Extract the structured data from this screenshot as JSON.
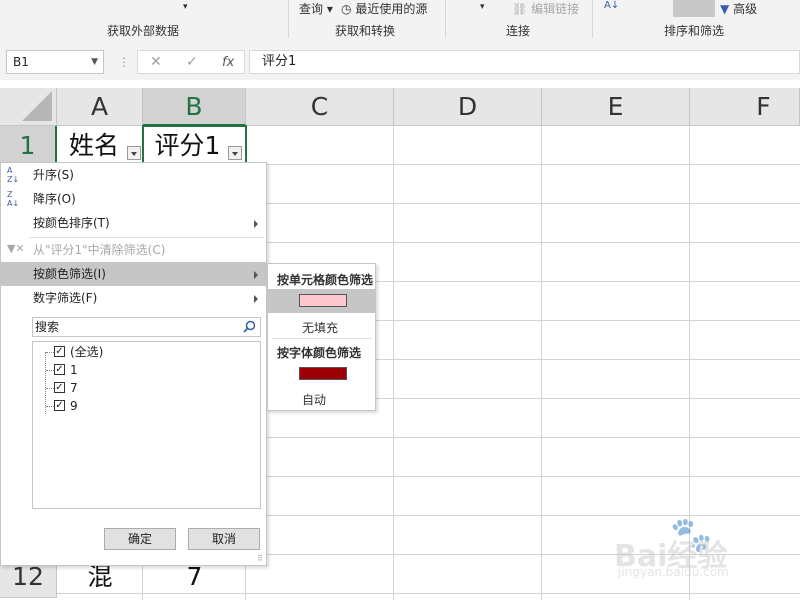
{
  "ribbon": {
    "groups": [
      {
        "label": "获取外部数据"
      },
      {
        "label": "获取和转换"
      },
      {
        "label": "连接"
      },
      {
        "label": "排序和筛选"
      }
    ],
    "query_label": "查询",
    "recent_sources_label": "最近使用的源",
    "edit_links_label": "编辑链接",
    "advanced_label": "高级"
  },
  "formula_bar": {
    "name_box": "B1",
    "cancel_icon": "✕",
    "confirm_icon": "✓",
    "fx_icon": "fx",
    "formula": "评分1"
  },
  "columns": [
    "A",
    "B",
    "C",
    "D",
    "E",
    "F"
  ],
  "rows": {
    "first": {
      "number": "1",
      "a": "姓名",
      "b": "评分1"
    },
    "last": {
      "number": "12",
      "a": "混",
      "b": "7"
    }
  },
  "filter_menu": {
    "sort_asc": "升序(S)",
    "sort_desc": "降序(O)",
    "sort_by_color": "按颜色排序(T)",
    "clear_filter": "从\"评分1\"中清除筛选(C)",
    "filter_by_color": "按颜色筛选(I)",
    "number_filter": "数字筛选(F)",
    "search_placeholder": "搜索",
    "items": [
      {
        "label": "(全选)",
        "checked": true
      },
      {
        "label": "1",
        "checked": true
      },
      {
        "label": "7",
        "checked": true
      },
      {
        "label": "9",
        "checked": true
      }
    ],
    "ok_label": "确定",
    "cancel_label": "取消"
  },
  "color_submenu": {
    "cell_color_header": "按单元格颜色筛选",
    "cell_color": "#ffc7ce",
    "no_fill_label": "无填充",
    "font_color_header": "按字体颜色筛选",
    "font_color": "#9c0006",
    "auto_label": "自动"
  },
  "watermark": {
    "brand": "Bai经验",
    "url": "jingyan.baidu.com"
  },
  "colors": {
    "excel_green": "#217346",
    "highlight": "#c6c6c6"
  }
}
